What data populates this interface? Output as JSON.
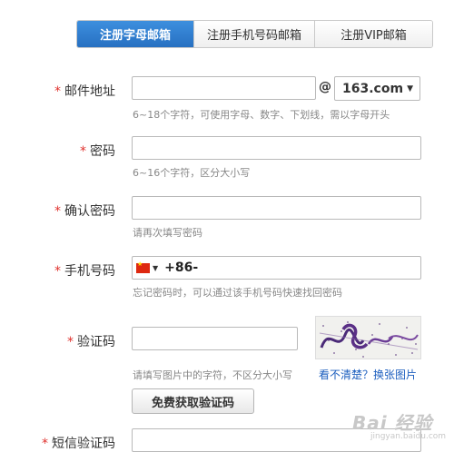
{
  "tabs": [
    {
      "label": "注册字母邮箱",
      "active": true
    },
    {
      "label": "注册手机号码邮箱",
      "active": false
    },
    {
      "label": "注册VIP邮箱",
      "active": false
    }
  ],
  "required_mark": "*",
  "email": {
    "label": "邮件地址",
    "value": "",
    "at_sign": "@",
    "domain": "163.com",
    "hint": "6~18个字符，可使用字母、数字、下划线，需以字母开头"
  },
  "password": {
    "label": "密码",
    "value": "",
    "hint": "6~16个字符，区分大小写"
  },
  "confirm_password": {
    "label": "确认密码",
    "value": "",
    "hint": "请再次填写密码"
  },
  "phone": {
    "label": "手机号码",
    "country_code": "+86-",
    "value": "",
    "hint": "忘记密码时，可以通过该手机号码快速找回密码"
  },
  "captcha": {
    "label": "验证码",
    "value": "",
    "hint": "请填写图片中的字符，不区分大小写",
    "refresh_link": "看不清楚？换张图片"
  },
  "sms_button": "免费获取验证码",
  "sms_code": {
    "label": "短信验证码",
    "value": ""
  },
  "watermark": {
    "text": "Bai 经验",
    "sub": "jingyan.baidu.com"
  },
  "colors": {
    "accent": "#2770c2",
    "required": "#e0312d",
    "link": "#1d5fbf",
    "hint": "#888888"
  }
}
